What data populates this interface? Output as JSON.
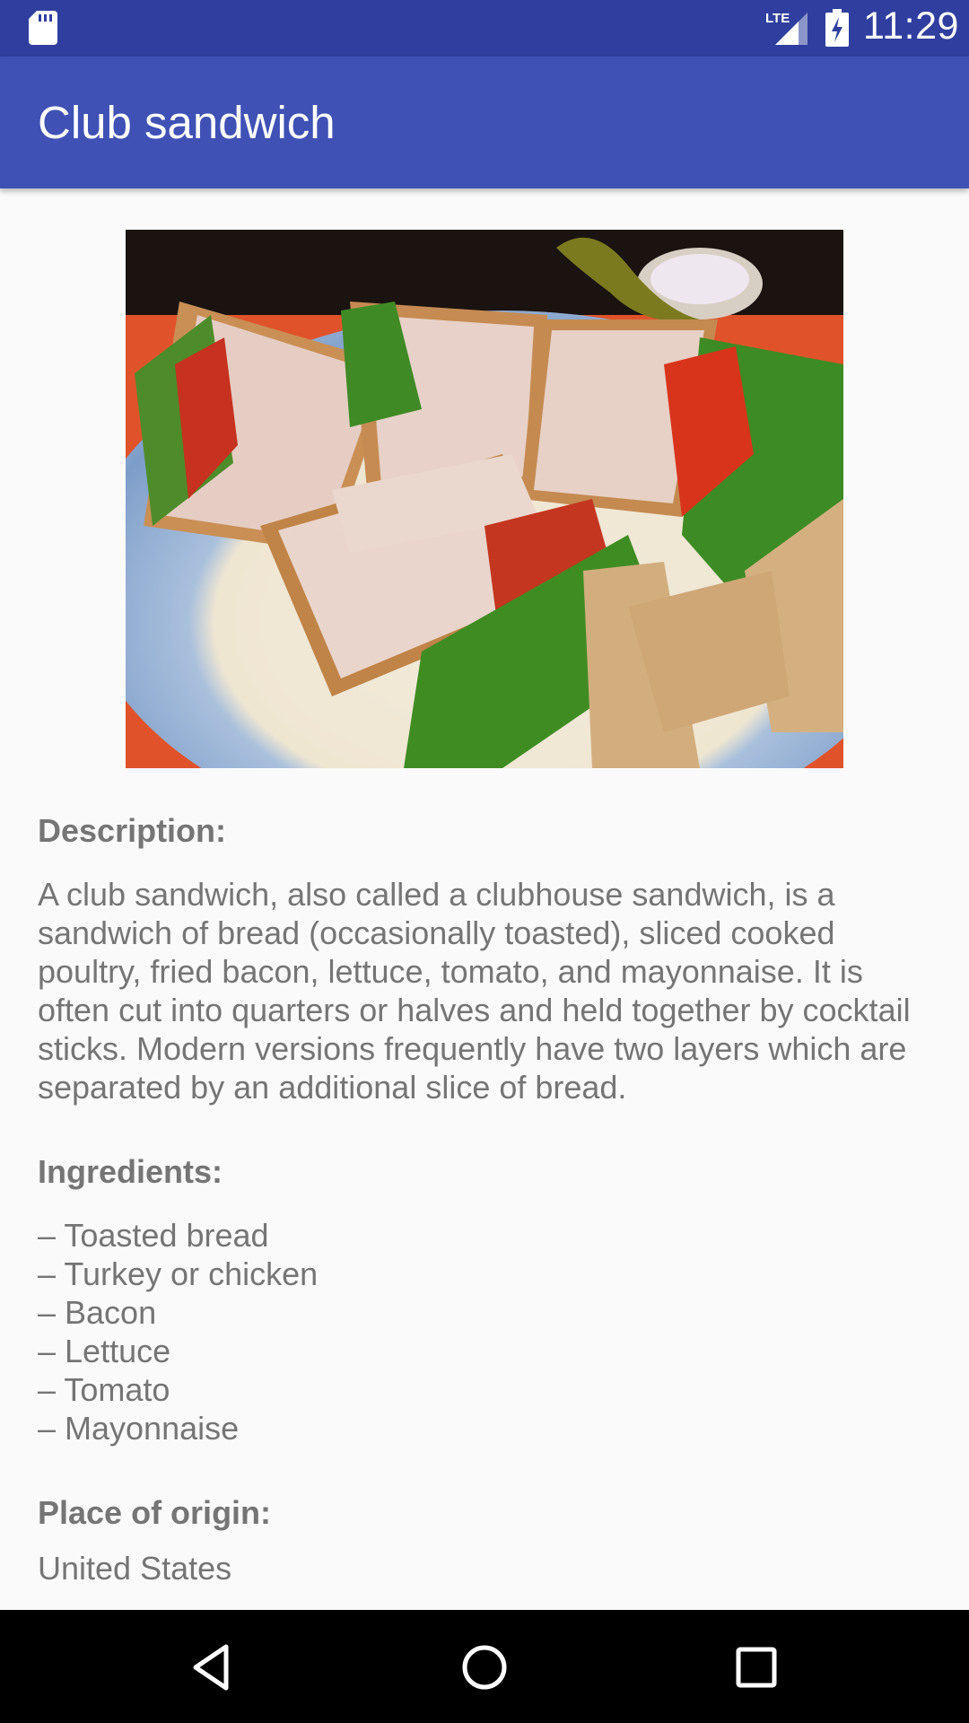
{
  "status_bar": {
    "time": "11:29",
    "network": "LTE",
    "icons": [
      "sd-card-icon",
      "lte-signal-icon",
      "battery-charging-icon"
    ]
  },
  "app_bar": {
    "title": "Club sandwich"
  },
  "image": {
    "subject": "club sandwich quarters on a blue-rimmed plate"
  },
  "description": {
    "label": "Description:",
    "text": "A club sandwich, also called a clubhouse sandwich, is a sandwich of bread (occasionally toasted), sliced cooked poultry, fried bacon, lettuce, tomato, and mayonnaise. It is often cut into quarters or halves and held together by cocktail sticks. Modern versions frequently have two layers which are separated by an additional slice of bread."
  },
  "ingredients": {
    "label": "Ingredients:",
    "items": [
      "– Toasted bread",
      "– Turkey or chicken",
      "– Bacon",
      "– Lettuce",
      "– Tomato",
      "– Mayonnaise"
    ]
  },
  "origin": {
    "label": "Place of origin:",
    "value": "United States"
  },
  "nav_bar": {
    "buttons": [
      "back-icon",
      "home-icon",
      "recents-icon"
    ]
  },
  "colors": {
    "status_bar": "#303f9f",
    "app_bar": "#3f51b5",
    "background": "#fafafa",
    "text": "#757575"
  }
}
